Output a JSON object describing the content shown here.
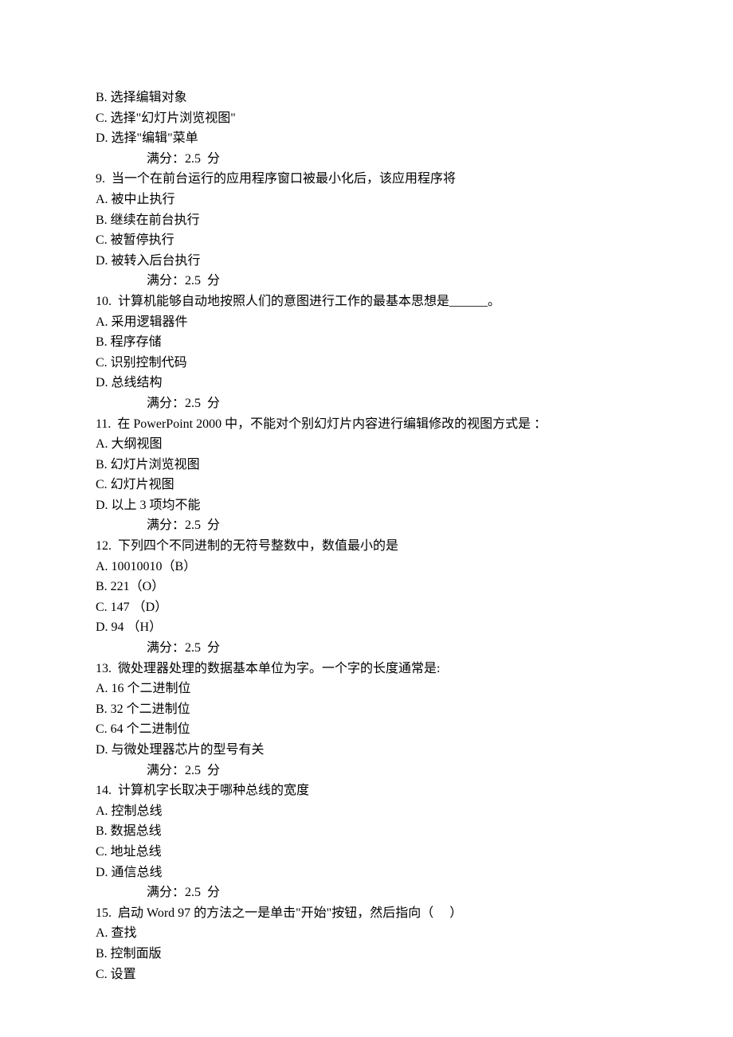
{
  "lines": {
    "q8_b": "B. 选择编辑对象",
    "q8_c": "C. 选择\"幻灯片浏览视图\"",
    "q8_d": "D. 选择\"编辑\"菜单",
    "score8": "满分：2.5  分",
    "q9": "9.  当一个在前台运行的应用程序窗口被最小化后，该应用程序将",
    "q9_a": "A. 被中止执行",
    "q9_b": "B. 继续在前台执行",
    "q9_c": "C. 被暂停执行",
    "q9_d": "D. 被转入后台执行",
    "score9": "满分：2.5  分",
    "q10": "10.  计算机能够自动地按照人们的意图进行工作的最基本思想是______。",
    "q10_a": "A. 采用逻辑器件",
    "q10_b": "B. 程序存储",
    "q10_c": "C. 识别控制代码",
    "q10_d": "D. 总线结构",
    "score10": "满分：2.5  分",
    "q11": "11.  在 PowerPoint 2000 中，不能对个别幻灯片内容进行编辑修改的视图方式是 ：",
    "q11_a": "A. 大纲视图",
    "q11_b": "B. 幻灯片浏览视图",
    "q11_c": "C. 幻灯片视图",
    "q11_d": "D. 以上 3 项均不能",
    "score11": "满分：2.5  分",
    "q12": "12.  下列四个不同进制的无符号整数中，数值最小的是",
    "q12_a": "A. 10010010（B）",
    "q12_b": "B. 221（O）",
    "q12_c": "C. 147 （D）",
    "q12_d": "D. 94 （H）",
    "score12": "满分：2.5  分",
    "q13": "13.  微处理器处理的数据基本单位为字。一个字的长度通常是:",
    "q13_a": "A. 16 个二进制位",
    "q13_b": "B. 32 个二进制位",
    "q13_c": "C. 64 个二进制位",
    "q13_d": "D. 与微处理器芯片的型号有关",
    "score13": "满分：2.5  分",
    "q14": "14.  计算机字长取决于哪种总线的宽度",
    "q14_a": "A. 控制总线",
    "q14_b": "B. 数据总线",
    "q14_c": "C. 地址总线",
    "q14_d": "D. 通信总线",
    "score14": "满分：2.5  分",
    "q15": "15.  启动 Word 97 的方法之一是单击\"开始\"按钮，然后指向（     ）",
    "q15_a": "A. 查找",
    "q15_b": "B. 控制面版",
    "q15_c": "C. 设置"
  }
}
